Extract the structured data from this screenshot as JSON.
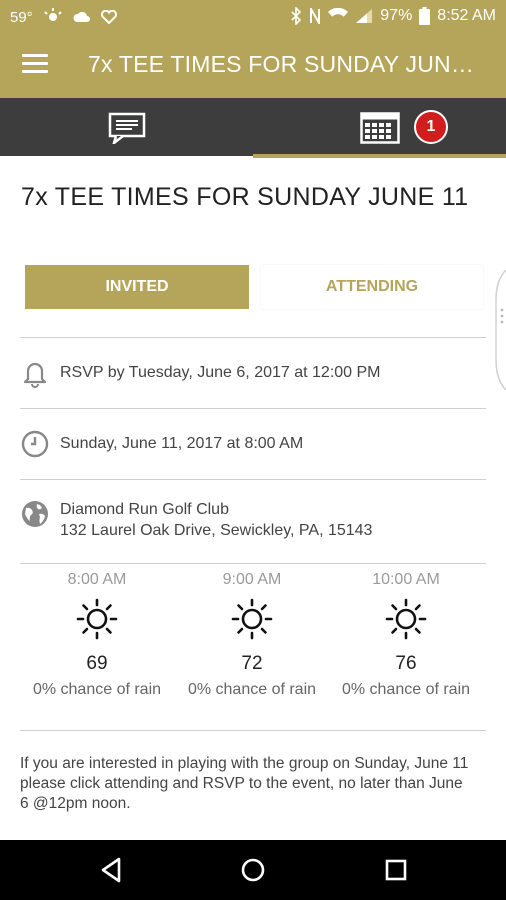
{
  "status_bar": {
    "temperature": "59°",
    "battery": "97%",
    "time": "8:52 AM",
    "icons": [
      "weather-icon",
      "cloud-icon",
      "heart-icon",
      "bluetooth-icon",
      "nfc-icon",
      "wifi-icon",
      "signal-icon",
      "battery-icon"
    ]
  },
  "app_bar": {
    "title": "7x TEE TIMES FOR SUNDAY JUNE 11",
    "menu_icon": "hamburger-menu-icon"
  },
  "tabs": {
    "left_icon": "chat-icon",
    "right_icon": "calendar-icon",
    "badge": "1",
    "active": "right"
  },
  "event": {
    "title": "7x TEE TIMES FOR SUNDAY JUNE 11",
    "invited_label": "INVITED",
    "attending_label": "ATTENDING",
    "rsvp": "RSVP by Tuesday, June 6, 2017 at 12:00 PM",
    "datetime": "Sunday, June 11, 2017 at 8:00 AM",
    "location_name": "Diamond Run Golf Club",
    "location_address": "132 Laurel Oak Drive, Sewickley, PA, 15143"
  },
  "weather": [
    {
      "time": "8:00 AM",
      "temp": "69",
      "rain": "0% chance of rain",
      "icon": "sun-icon"
    },
    {
      "time": "9:00 AM",
      "temp": "72",
      "rain": "0% chance of rain",
      "icon": "sun-icon"
    },
    {
      "time": "10:00 AM",
      "temp": "76",
      "rain": "0% chance of rain",
      "icon": "sun-icon"
    }
  ],
  "description": "If you are interested in playing with the group on Sunday, June 11 please click attending and RSVP to the event, no later than June 6 @12pm noon.",
  "colors": {
    "accent": "#b5a55a",
    "tab_bar": "#3d3d3d",
    "badge": "#d01e1e"
  },
  "nav": [
    "back-icon",
    "home-icon",
    "recents-icon"
  ]
}
